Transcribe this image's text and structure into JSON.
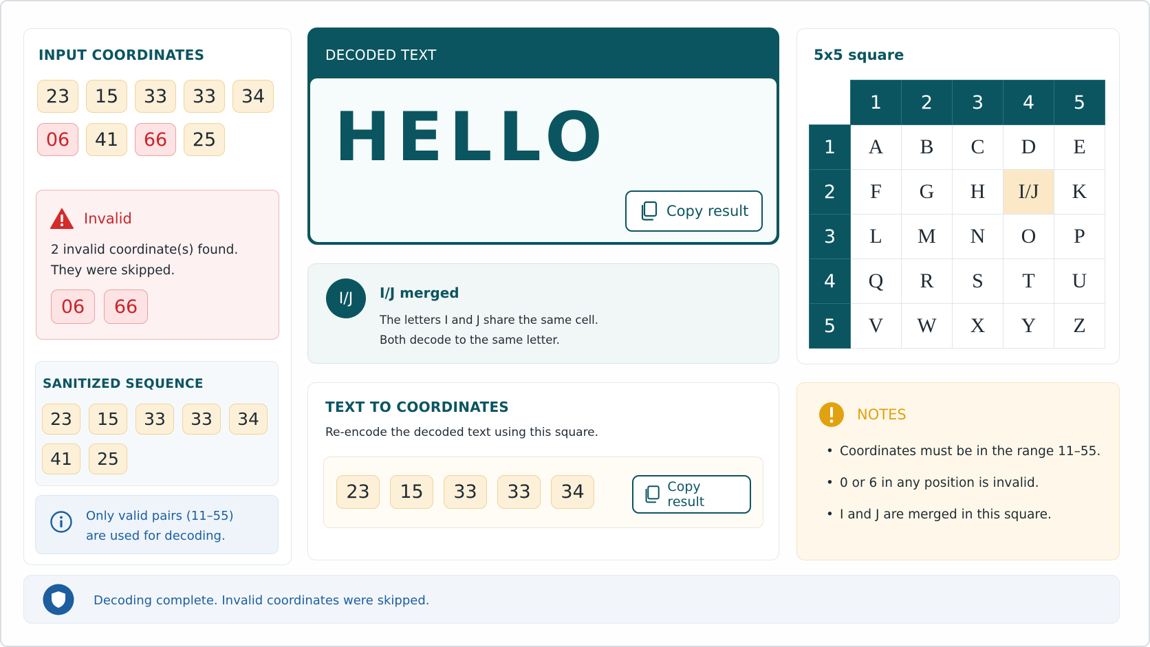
{
  "input": {
    "title": "INPUT COORDINATES",
    "row1": [
      "23",
      "15",
      "33",
      "33",
      "34"
    ],
    "row2": [
      "06",
      "41",
      "66",
      "25"
    ]
  },
  "invalid": {
    "title": "Invalid",
    "line1": "2 invalid coordinate(s) found.",
    "line2": "They were skipped.",
    "codes": [
      "06",
      "66"
    ]
  },
  "sanitized": {
    "title": "SANITIZED SEQUENCE",
    "row1": [
      "23",
      "15",
      "33",
      "33",
      "34"
    ],
    "row2": [
      "41",
      "25"
    ]
  },
  "info": {
    "line1": "Only valid pairs (11–55)",
    "line2": "are used for decoding."
  },
  "decoded": {
    "title": "DECODED TEXT",
    "text": "HELLO",
    "copy_label": "Copy result"
  },
  "merge": {
    "badge": "I/J",
    "title": "I/J merged",
    "line1": "The letters I and J share the same cell.",
    "line2": "Both decode to the same letter."
  },
  "t2c": {
    "title": "TEXT TO COORDINATES",
    "subtitle": "Re-encode the decoded text using this square.",
    "codes": [
      "23",
      "15",
      "33",
      "33",
      "34"
    ],
    "copy_label": "Copy result"
  },
  "square": {
    "title": "5x5 square",
    "cols": [
      "1",
      "2",
      "3",
      "4",
      "5"
    ],
    "rows": [
      {
        "h": "1",
        "cells": [
          "A",
          "B",
          "C",
          "D",
          "E"
        ]
      },
      {
        "h": "2",
        "cells": [
          "F",
          "G",
          "H",
          "I/J",
          "K"
        ]
      },
      {
        "h": "3",
        "cells": [
          "L",
          "M",
          "N",
          "O",
          "P"
        ]
      },
      {
        "h": "4",
        "cells": [
          "Q",
          "R",
          "S",
          "T",
          "U"
        ]
      },
      {
        "h": "5",
        "cells": [
          "V",
          "W",
          "X",
          "Y",
          "Z"
        ]
      }
    ]
  },
  "notes": {
    "title": "NOTES",
    "items": [
      "Coordinates must be in the range 11–55.",
      "0 or 6 in any position is invalid.",
      "I and J are merged in this square."
    ]
  },
  "status": {
    "message": "Decoding complete. Invalid coordinates were skipped."
  },
  "colors": {
    "accent": "#0b5560",
    "warning": "#c7262b",
    "chip": "#fdf0d8",
    "notes_accent": "#e2a10f",
    "info": "#1d5e9e"
  }
}
